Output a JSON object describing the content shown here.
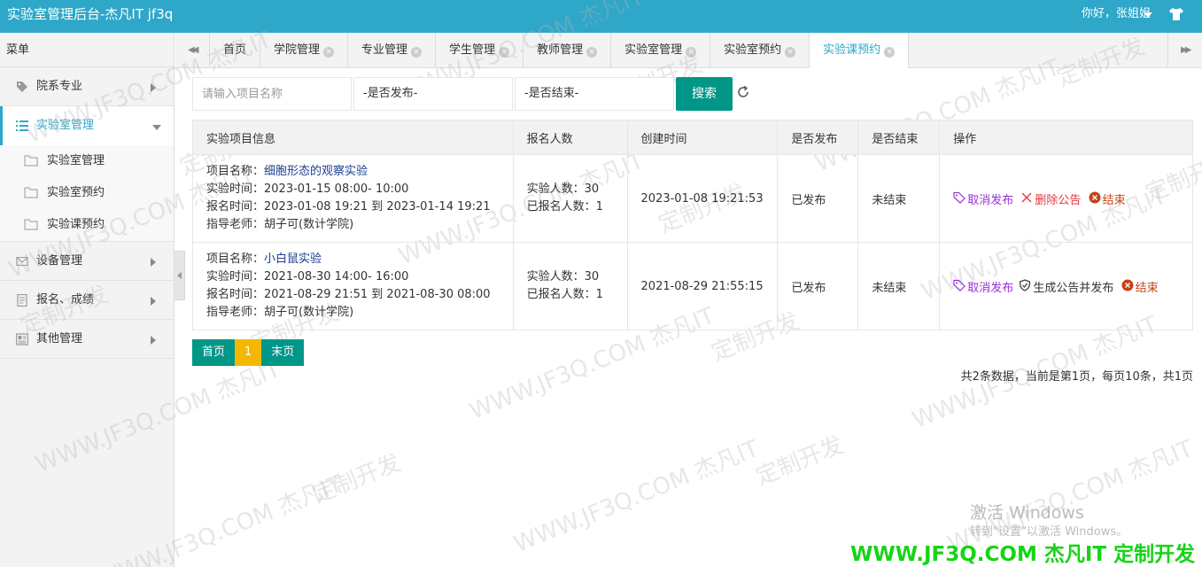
{
  "app": {
    "title": "实验室管理后台-杰凡IT jf3q",
    "greeting": "你好，张姐姐"
  },
  "sidebar": {
    "header": "菜单",
    "items": [
      {
        "label": "院系专业",
        "icon": "tag-icon"
      },
      {
        "label": "实验室管理",
        "icon": "list-icon",
        "active": true,
        "children": [
          {
            "label": "实验室管理",
            "icon": "folder-icon"
          },
          {
            "label": "实验室预约",
            "icon": "folder-icon"
          },
          {
            "label": "实验课预约",
            "icon": "folder-icon"
          }
        ]
      },
      {
        "label": "设备管理",
        "icon": "mail-icon"
      },
      {
        "label": "报名、成绩",
        "icon": "document-icon"
      },
      {
        "label": "其他管理",
        "icon": "newspaper-icon"
      }
    ]
  },
  "tabs": [
    {
      "label": "首页"
    },
    {
      "label": "学院管理"
    },
    {
      "label": "专业管理"
    },
    {
      "label": "学生管理"
    },
    {
      "label": "教师管理"
    },
    {
      "label": "实验室管理"
    },
    {
      "label": "实验室预约"
    },
    {
      "label": "实验课预约",
      "active": true
    }
  ],
  "search": {
    "placeholder": "请输入项目名称",
    "published_select": "-是否发布-",
    "ended_select": "-是否结束-",
    "button": "搜索"
  },
  "table": {
    "headers": [
      "实验项目信息",
      "报名人数",
      "创建时间",
      "是否发布",
      "是否结束",
      "操作"
    ],
    "rows": [
      {
        "name_label": "项目名称：",
        "name": "细胞形态的观察实验",
        "time": "实验时间：2023-01-15 08:00- 10:00",
        "signup": "报名时间：2023-01-08 19:21 到 2023-01-14 19:21",
        "teacher": "指导老师：胡子可(数计学院)",
        "capacity": "实验人数：30",
        "enrolled": "已报名人数：1",
        "created": "2023-01-08 19:21:53",
        "published": "已发布",
        "ended": "未结束",
        "op1": "取消发布",
        "op2": "删除公告",
        "op3": "结束"
      },
      {
        "name_label": "项目名称：",
        "name": "小白鼠实验",
        "time": "实验时间：2021-08-30 14:00- 16:00",
        "signup": "报名时间：2021-08-29 21:51 到 2021-08-30 08:00",
        "teacher": "指导老师：胡子可(数计学院)",
        "capacity": "实验人数：30",
        "enrolled": "已报名人数：1",
        "created": "2021-08-29 21:55:15",
        "published": "已发布",
        "ended": "未结束",
        "op1": "取消发布",
        "op2": "生成公告并发布",
        "op3": "结束"
      }
    ]
  },
  "pager": {
    "first": "首页",
    "current": "1",
    "last": "末页"
  },
  "summary": "共2条数据，当前是第1页，每页10条，共1页",
  "watermark": {
    "text1": "WWW.JF3Q.COM 杰凡IT",
    "text2": "定制开发"
  },
  "windows": {
    "line1": "激活 Windows",
    "line2": "转到\"设置\"以激活 Windows。"
  },
  "brand_footer": "WWW.JF3Q.COM 杰凡IT  定制开发",
  "colors": {
    "header": "#2ea7c9",
    "primary_button": "#009688",
    "current_page": "#f5b800",
    "link": "#1f39a0",
    "op_purple": "#9b30d4",
    "op_red": "#e6353c",
    "op_brown": "#c44315"
  }
}
